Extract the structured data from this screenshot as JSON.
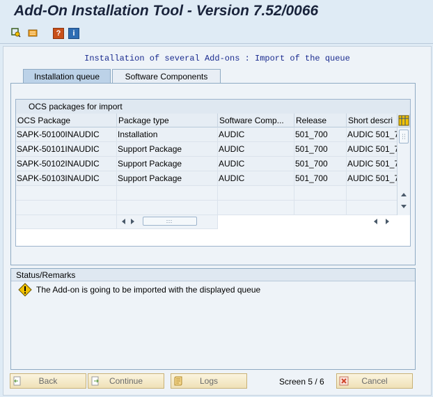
{
  "window": {
    "title": "Add-On Installation Tool - Version 7.52/0066"
  },
  "toolbar": {
    "icons": [
      "display-icon",
      "transport-icon",
      "help-icon",
      "info-icon"
    ],
    "help_glyph": "?",
    "info_glyph": "i"
  },
  "page": {
    "subtitle": "Installation of several Add-ons : Import of the queue"
  },
  "tabs": [
    {
      "label": "Installation queue",
      "active": true
    },
    {
      "label": "Software Components",
      "active": false
    }
  ],
  "grid": {
    "caption": "OCS packages for import",
    "columns": [
      "OCS Package",
      "Package type",
      "Software Comp...",
      "Release",
      "Short descri"
    ],
    "rows": [
      [
        "SAPK-50100INAUDIC",
        "Installation",
        "AUDIC",
        "501_700",
        "AUDIC 501_7"
      ],
      [
        "SAPK-50101INAUDIC",
        "Support Package",
        "AUDIC",
        "501_700",
        "AUDIC 501_7"
      ],
      [
        "SAPK-50102INAUDIC",
        "Support Package",
        "AUDIC",
        "501_700",
        "AUDIC 501_7"
      ],
      [
        "SAPK-50103INAUDIC",
        "Support Package",
        "AUDIC",
        "501_700",
        "AUDIC 501_7"
      ]
    ],
    "empty_rows": 3
  },
  "status": {
    "header": "Status/Remarks",
    "message": "The Add-on is going to be imported with the displayed queue"
  },
  "footer": {
    "back_label": "Back",
    "continue_label": "Continue",
    "logs_label": "Logs",
    "screen_label": "Screen 5 / 6",
    "cancel_label": "Cancel"
  },
  "colors": {
    "title": "#19233b",
    "subtitle": "#1a2b8f",
    "tab_active": "#bcd2e8",
    "warning": "#f2c200"
  }
}
